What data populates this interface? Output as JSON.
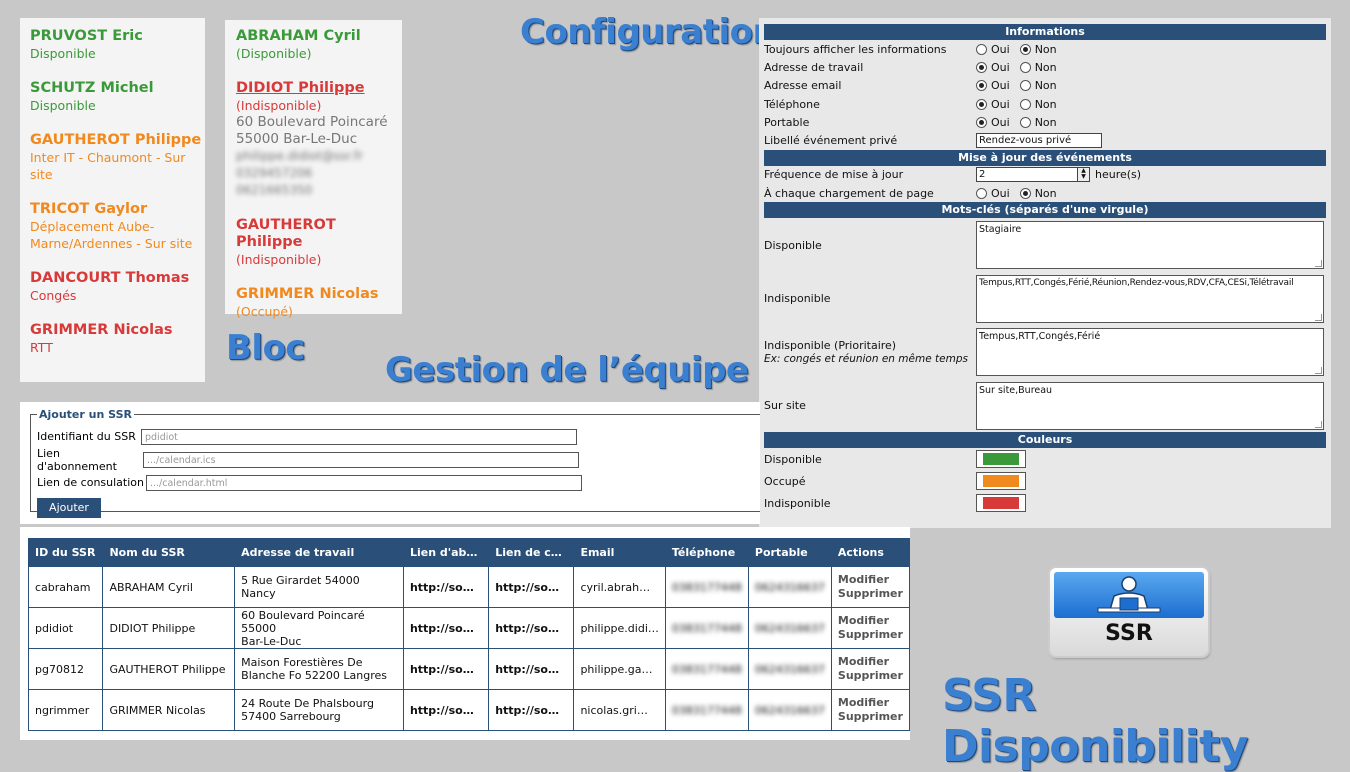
{
  "colors": {
    "green": "#3a9a3a",
    "orange": "#f0891e",
    "red": "#d83a3a",
    "navy": "#2a4f78",
    "title_blue": "#3a7fd0"
  },
  "titles": {
    "configuration": "Configuration",
    "bloc": "Bloc",
    "gestion": "Gestion de l’équipe",
    "app": "SSR Disponibility",
    "logo": "SSR"
  },
  "bloc_left": [
    {
      "name": "PRUVOST Eric",
      "status": "Disponible",
      "color": "green"
    },
    {
      "name": "SCHUTZ Michel",
      "status": "Disponible",
      "color": "green"
    },
    {
      "name": "GAUTHEROT Philippe",
      "status": "Inter IT - Chaumont - Sur site",
      "color": "orange"
    },
    {
      "name": "TRICOT Gaylor",
      "status": "Déplacement Aube-Marne/Ardennes - Sur site",
      "color": "orange"
    },
    {
      "name": "DANCOURT Thomas",
      "status": "Congés",
      "color": "red"
    },
    {
      "name": "GRIMMER Nicolas",
      "status": "RTT",
      "color": "red"
    }
  ],
  "bloc_right": {
    "p1": {
      "name": "ABRAHAM Cyril",
      "status": "(Disponible)"
    },
    "p2": {
      "name": "DIDIOT Philippe",
      "status": "(Indisponible)",
      "address1": "60 Boulevard Poincaré",
      "address2": "55000 Bar-Le-Duc",
      "email": "philippe.didiot@ssr.fr",
      "phone": "0329457206",
      "mobile": "0621665350"
    },
    "p3": {
      "name": "GAUTHEROT Philippe",
      "status": "(Indisponible)"
    },
    "p4": {
      "name": "GRIMMER Nicolas",
      "status": "(Occupé)"
    }
  },
  "config": {
    "sec_info": "Informations",
    "always_show": "Toujours afficher les informations",
    "work_address": "Adresse de travail",
    "email": "Adresse email",
    "phone": "Téléphone",
    "mobile": "Portable",
    "private_label": "Libellé événement privé",
    "private_value": "Rendez-vous privé",
    "oui": "Oui",
    "non": "Non",
    "sec_update": "Mise à jour des événements",
    "freq": "Fréquence de mise à jour",
    "freq_value": "2",
    "hours": "heure(s)",
    "each_load": "À chaque chargement de page",
    "sec_keywords": "Mots-clés (séparés d'une virgule)",
    "kw_available": "Disponible",
    "kw_available_value": "Stagiaire",
    "kw_unavailable": "Indisponible",
    "kw_unavailable_value": "Tempus,RTT,Congés,Férié,Réunion,Rendez-vous,RDV,CFA,CESi,Télétravail",
    "kw_priority": "Indisponible (Prioritaire)",
    "kw_priority_hint": "Ex: congés et réunion en même temps",
    "kw_priority_value": "Tempus,RTT,Congés,Férié",
    "kw_onsite": "Sur site",
    "kw_onsite_value": "Sur site,Bureau",
    "sec_colors": "Couleurs",
    "col_available": "Disponible",
    "col_busy": "Occupé",
    "col_unavailable": "Indisponible",
    "swatch_available": "#3a9a3a",
    "swatch_busy": "#f0891e",
    "swatch_unavailable": "#d83a3a"
  },
  "add_ssr": {
    "legend": "Ajouter un SSR",
    "id_label": "Identifiant du SSR",
    "id_placeholder": "pdidiot",
    "sub_label": "Lien d'abonnement",
    "sub_placeholder": ".../calendar.ics",
    "view_label": "Lien de consulation",
    "view_placeholder": ".../calendar.html",
    "button": "Ajouter"
  },
  "table": {
    "headers": [
      "ID du SSR",
      "Nom du SSR",
      "Adresse de travail",
      "Lien d'ab…",
      "Lien de c…",
      "Email",
      "Téléphone",
      "Portable",
      "Actions"
    ],
    "modify": "Modifier",
    "delete": "Supprimer",
    "rows": [
      {
        "id": "cabraham",
        "name": "ABRAHAM Cyril",
        "addr1": "5 Rue Girardet 54000 Nancy",
        "addr2": "",
        "sub": "http://so…",
        "view": "http://so…",
        "email": "cyril.abrah…",
        "phone": "0383177448",
        "mobile": "0624316637"
      },
      {
        "id": "pdidiot",
        "name": "DIDIOT Philippe",
        "addr1": "60 Boulevard Poincaré 55000",
        "addr2": "Bar-Le-Duc",
        "sub": "http://so…",
        "view": "http://so…",
        "email": "philippe.didi…",
        "phone": "0383177448",
        "mobile": "0624316637"
      },
      {
        "id": "pg70812",
        "name": "GAUTHEROT Philippe",
        "addr1": "Maison Forestières De",
        "addr2": "Blanche Fo 52200 Langres",
        "sub": "http://so…",
        "view": "http://so…",
        "email": "philippe.ga…",
        "phone": "0383177448",
        "mobile": "0624316637"
      },
      {
        "id": "ngrimmer",
        "name": "GRIMMER Nicolas",
        "addr1": "24 Route De Phalsbourg",
        "addr2": "57400 Sarrebourg",
        "sub": "http://so…",
        "view": "http://so…",
        "email": "nicolas.gri…",
        "phone": "0383177448",
        "mobile": "0624316637"
      }
    ]
  }
}
